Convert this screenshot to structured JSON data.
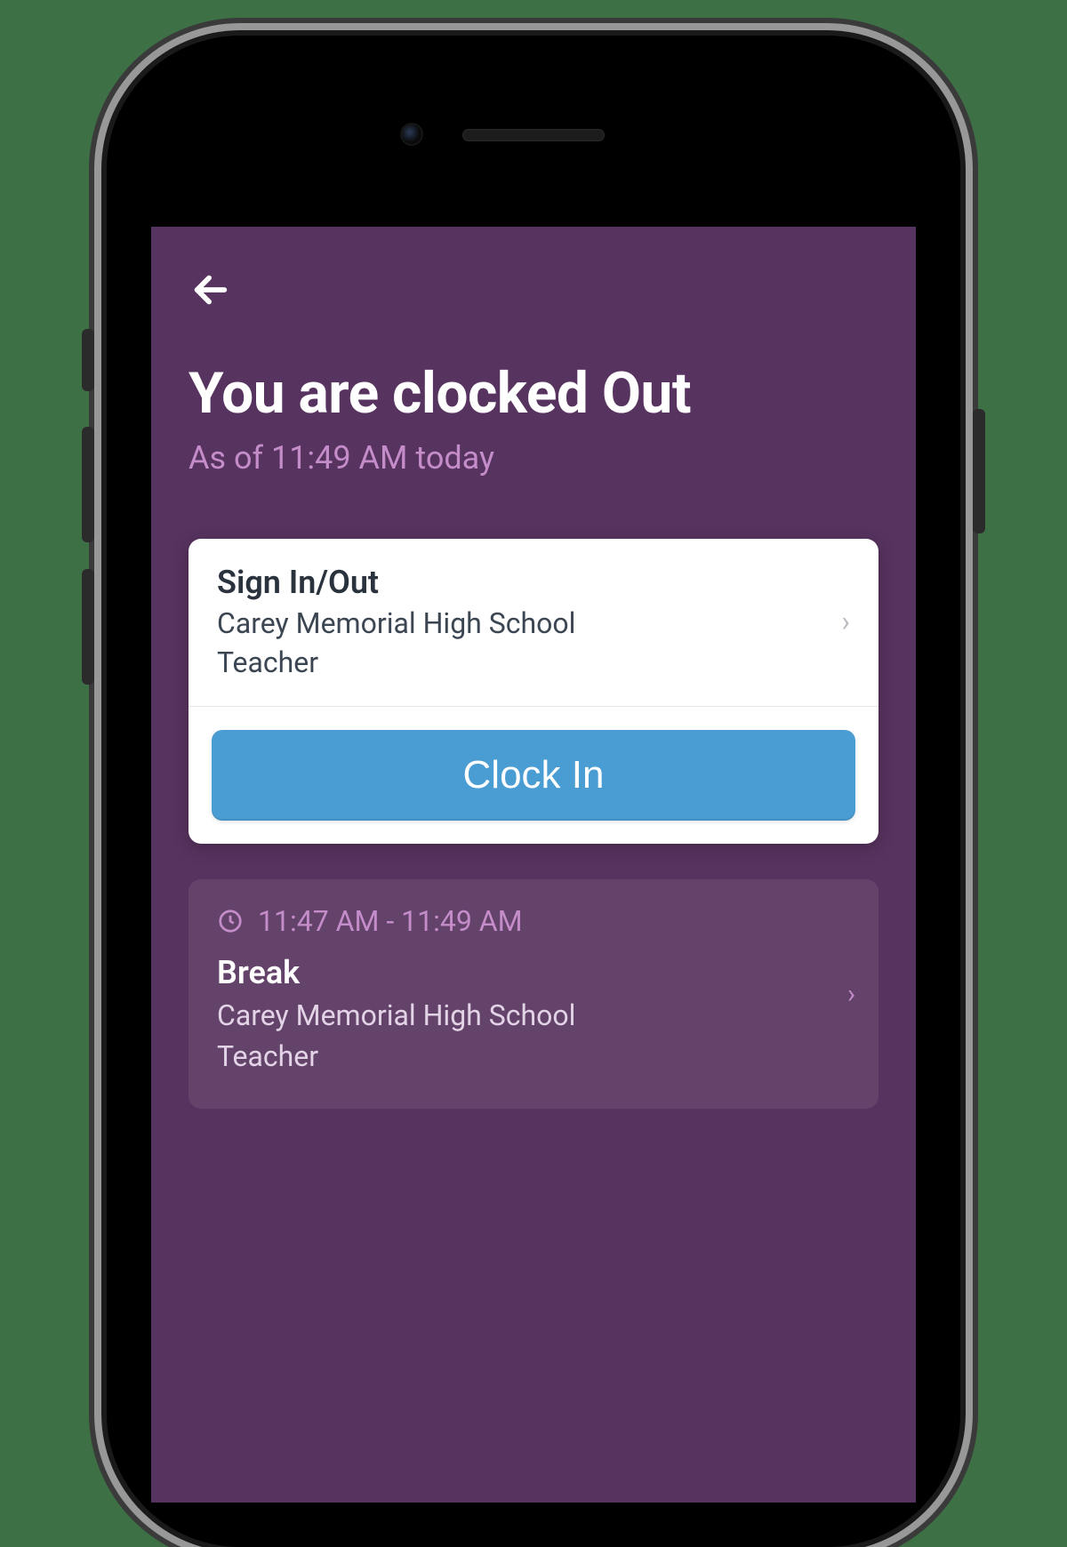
{
  "header": {
    "title": "You are clocked Out",
    "subtitle": "As of 11:49 AM today"
  },
  "card": {
    "row_title": "Sign In/Out",
    "location": "Carey Memorial High School",
    "role": "Teacher",
    "button_label": "Clock In"
  },
  "history": {
    "time_range": "11:47 AM - 11:49 AM",
    "label": "Break",
    "location": "Carey Memorial High School",
    "role": "Teacher"
  }
}
